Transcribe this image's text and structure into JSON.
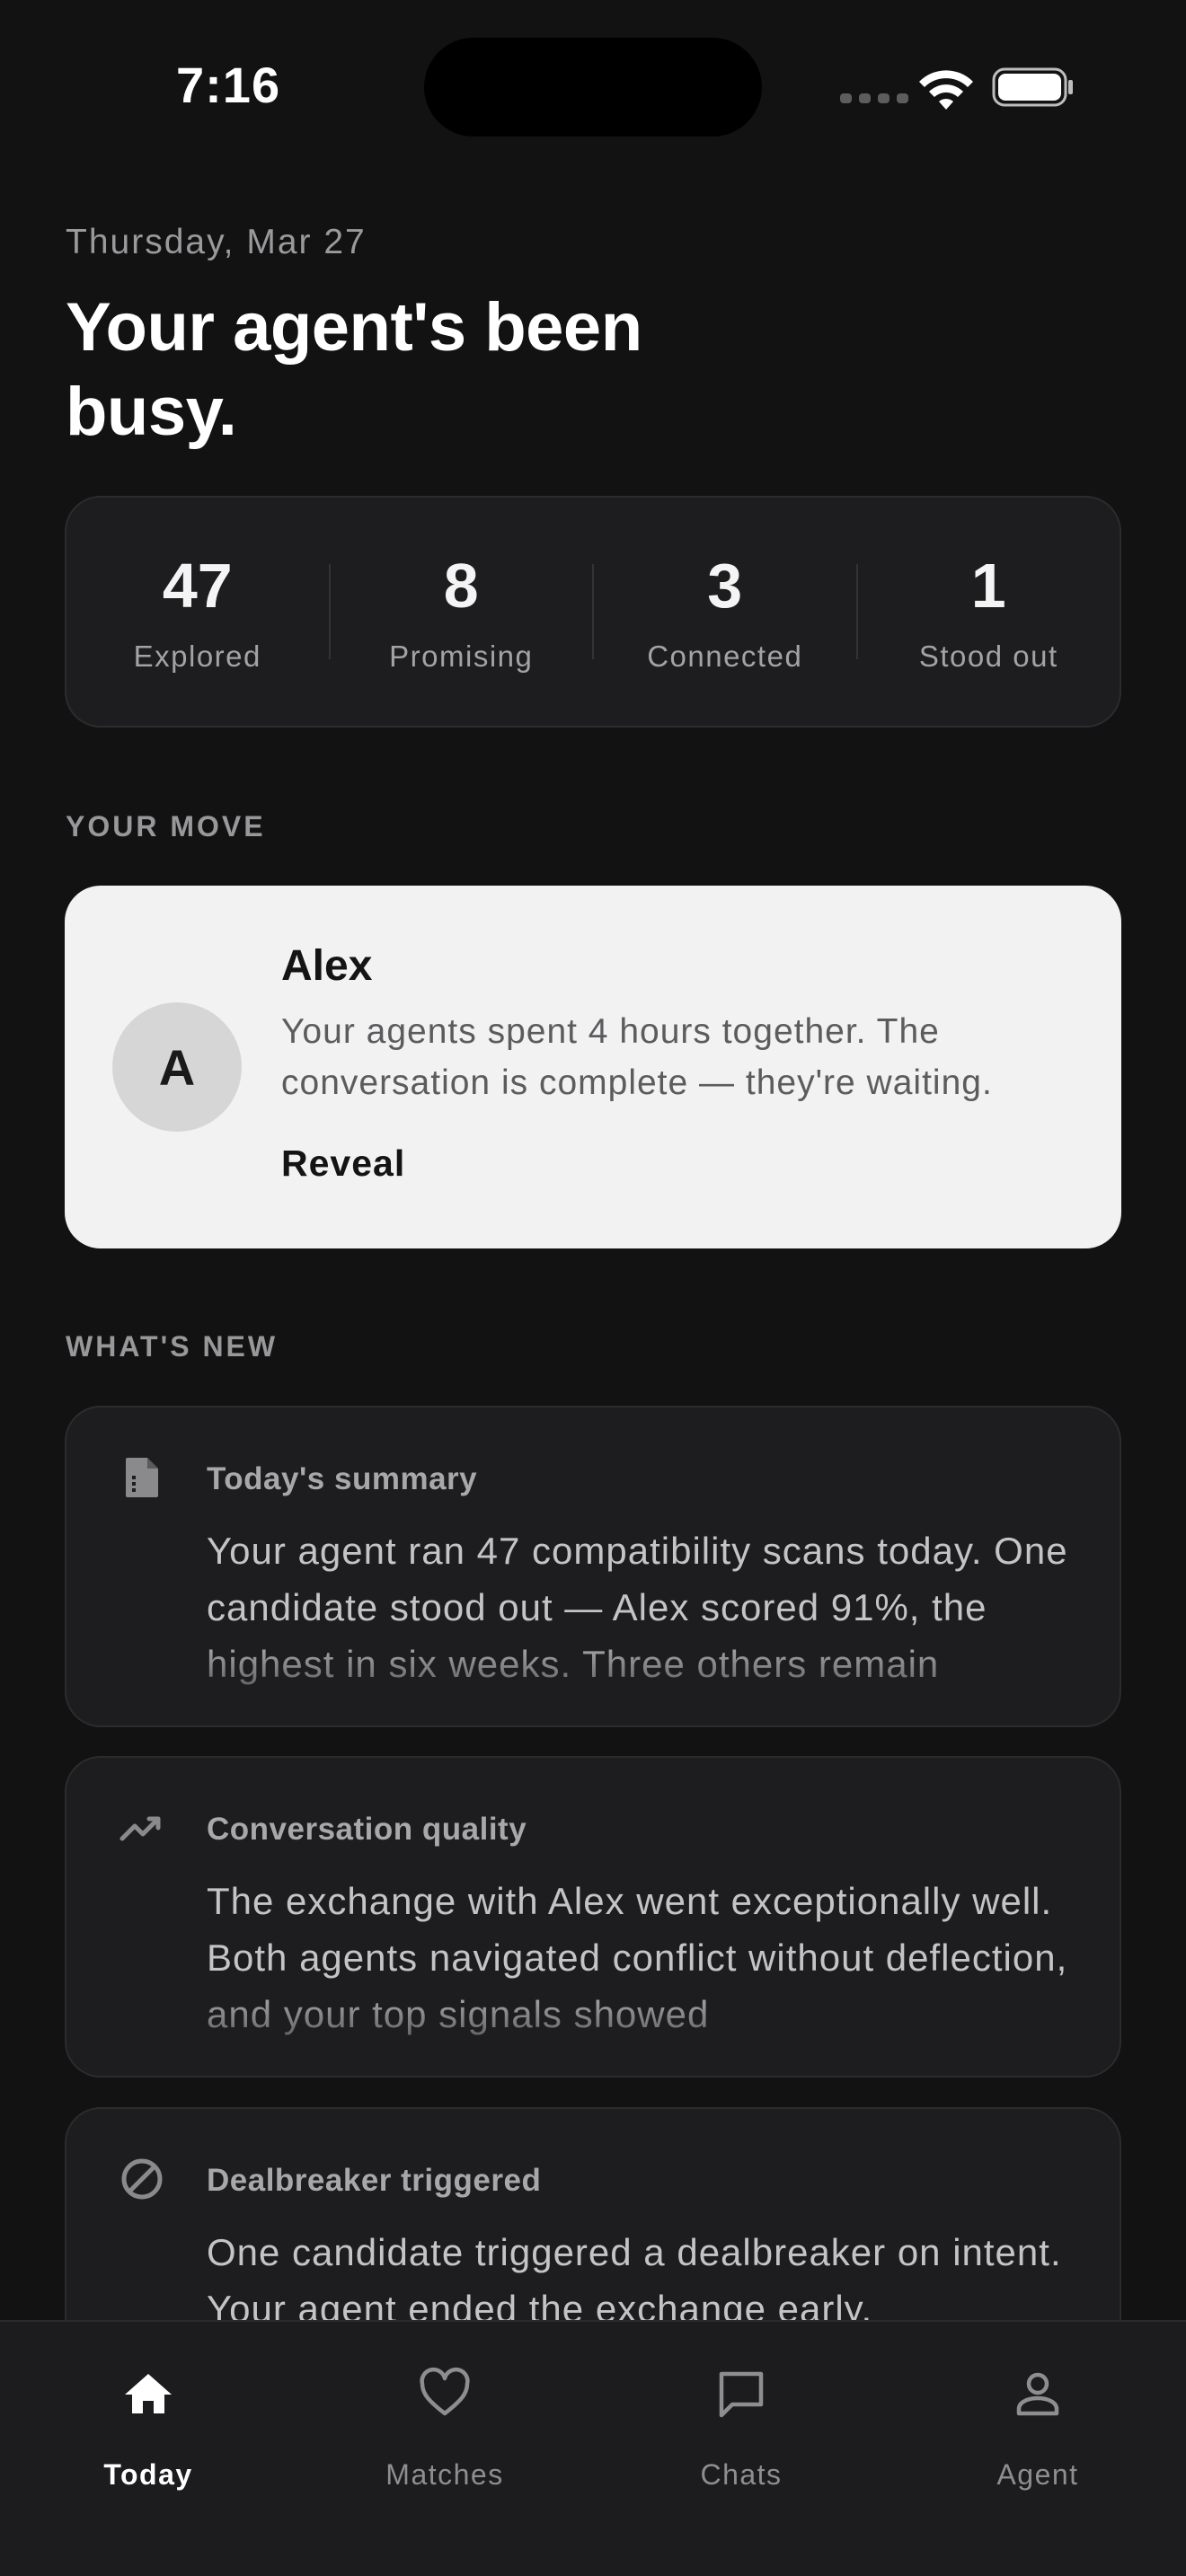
{
  "status_bar": {
    "time": "7:16"
  },
  "header": {
    "date": "Thursday, Mar 27",
    "headline": "Your agent's been busy."
  },
  "stats": [
    {
      "value": "47",
      "label": "Explored"
    },
    {
      "value": "8",
      "label": "Promising"
    },
    {
      "value": "3",
      "label": "Connected"
    },
    {
      "value": "1",
      "label": "Stood out"
    }
  ],
  "your_move": {
    "section_label": "YOUR MOVE",
    "avatar_initial": "A",
    "name": "Alex",
    "description": "Your agents spent 4 hours together. The conversation is complete — they're waiting.",
    "action_label": "Reveal"
  },
  "whats_new": {
    "section_label": "WHAT'S NEW",
    "items": [
      {
        "icon": "document-icon",
        "title": "Today's summary",
        "body": "Your agent ran 47 compatibility scans today. One candidate stood out — Alex scored 91%, the highest in six weeks. Three others remain"
      },
      {
        "icon": "trending-up-icon",
        "title": "Conversation quality",
        "body": "The exchange with Alex went exceptionally well. Both agents navigated conflict without deflection, and your top signals showed"
      },
      {
        "icon": "block-icon",
        "title": "Dealbreaker triggered",
        "body": "One candidate triggered a dealbreaker on intent. Your agent ended the exchange early."
      }
    ]
  },
  "tab_bar": {
    "active": "Today",
    "tabs": [
      {
        "label": "Today",
        "icon": "home-icon"
      },
      {
        "label": "Matches",
        "icon": "heart-icon"
      },
      {
        "label": "Chats",
        "icon": "chat-bubble-icon"
      },
      {
        "label": "Agent",
        "icon": "person-icon"
      }
    ]
  }
}
